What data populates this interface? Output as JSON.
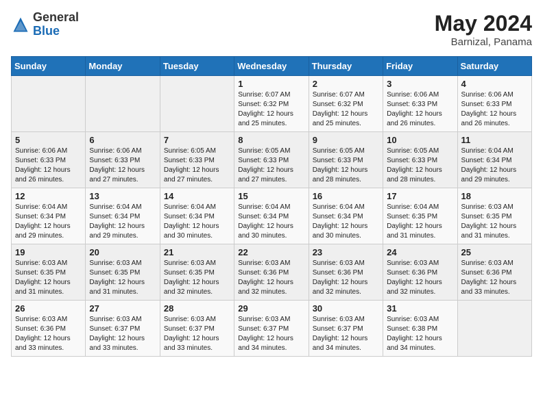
{
  "header": {
    "logo_general": "General",
    "logo_blue": "Blue",
    "month_year": "May 2024",
    "location": "Barnizal, Panama"
  },
  "weekdays": [
    "Sunday",
    "Monday",
    "Tuesday",
    "Wednesday",
    "Thursday",
    "Friday",
    "Saturday"
  ],
  "weeks": [
    [
      {
        "day": "",
        "info": ""
      },
      {
        "day": "",
        "info": ""
      },
      {
        "day": "",
        "info": ""
      },
      {
        "day": "1",
        "info": "Sunrise: 6:07 AM\nSunset: 6:32 PM\nDaylight: 12 hours\nand 25 minutes."
      },
      {
        "day": "2",
        "info": "Sunrise: 6:07 AM\nSunset: 6:32 PM\nDaylight: 12 hours\nand 25 minutes."
      },
      {
        "day": "3",
        "info": "Sunrise: 6:06 AM\nSunset: 6:33 PM\nDaylight: 12 hours\nand 26 minutes."
      },
      {
        "day": "4",
        "info": "Sunrise: 6:06 AM\nSunset: 6:33 PM\nDaylight: 12 hours\nand 26 minutes."
      }
    ],
    [
      {
        "day": "5",
        "info": "Sunrise: 6:06 AM\nSunset: 6:33 PM\nDaylight: 12 hours\nand 26 minutes."
      },
      {
        "day": "6",
        "info": "Sunrise: 6:06 AM\nSunset: 6:33 PM\nDaylight: 12 hours\nand 27 minutes."
      },
      {
        "day": "7",
        "info": "Sunrise: 6:05 AM\nSunset: 6:33 PM\nDaylight: 12 hours\nand 27 minutes."
      },
      {
        "day": "8",
        "info": "Sunrise: 6:05 AM\nSunset: 6:33 PM\nDaylight: 12 hours\nand 27 minutes."
      },
      {
        "day": "9",
        "info": "Sunrise: 6:05 AM\nSunset: 6:33 PM\nDaylight: 12 hours\nand 28 minutes."
      },
      {
        "day": "10",
        "info": "Sunrise: 6:05 AM\nSunset: 6:33 PM\nDaylight: 12 hours\nand 28 minutes."
      },
      {
        "day": "11",
        "info": "Sunrise: 6:04 AM\nSunset: 6:34 PM\nDaylight: 12 hours\nand 29 minutes."
      }
    ],
    [
      {
        "day": "12",
        "info": "Sunrise: 6:04 AM\nSunset: 6:34 PM\nDaylight: 12 hours\nand 29 minutes."
      },
      {
        "day": "13",
        "info": "Sunrise: 6:04 AM\nSunset: 6:34 PM\nDaylight: 12 hours\nand 29 minutes."
      },
      {
        "day": "14",
        "info": "Sunrise: 6:04 AM\nSunset: 6:34 PM\nDaylight: 12 hours\nand 30 minutes."
      },
      {
        "day": "15",
        "info": "Sunrise: 6:04 AM\nSunset: 6:34 PM\nDaylight: 12 hours\nand 30 minutes."
      },
      {
        "day": "16",
        "info": "Sunrise: 6:04 AM\nSunset: 6:34 PM\nDaylight: 12 hours\nand 30 minutes."
      },
      {
        "day": "17",
        "info": "Sunrise: 6:04 AM\nSunset: 6:35 PM\nDaylight: 12 hours\nand 31 minutes."
      },
      {
        "day": "18",
        "info": "Sunrise: 6:03 AM\nSunset: 6:35 PM\nDaylight: 12 hours\nand 31 minutes."
      }
    ],
    [
      {
        "day": "19",
        "info": "Sunrise: 6:03 AM\nSunset: 6:35 PM\nDaylight: 12 hours\nand 31 minutes."
      },
      {
        "day": "20",
        "info": "Sunrise: 6:03 AM\nSunset: 6:35 PM\nDaylight: 12 hours\nand 31 minutes."
      },
      {
        "day": "21",
        "info": "Sunrise: 6:03 AM\nSunset: 6:35 PM\nDaylight: 12 hours\nand 32 minutes."
      },
      {
        "day": "22",
        "info": "Sunrise: 6:03 AM\nSunset: 6:36 PM\nDaylight: 12 hours\nand 32 minutes."
      },
      {
        "day": "23",
        "info": "Sunrise: 6:03 AM\nSunset: 6:36 PM\nDaylight: 12 hours\nand 32 minutes."
      },
      {
        "day": "24",
        "info": "Sunrise: 6:03 AM\nSunset: 6:36 PM\nDaylight: 12 hours\nand 32 minutes."
      },
      {
        "day": "25",
        "info": "Sunrise: 6:03 AM\nSunset: 6:36 PM\nDaylight: 12 hours\nand 33 minutes."
      }
    ],
    [
      {
        "day": "26",
        "info": "Sunrise: 6:03 AM\nSunset: 6:36 PM\nDaylight: 12 hours\nand 33 minutes."
      },
      {
        "day": "27",
        "info": "Sunrise: 6:03 AM\nSunset: 6:37 PM\nDaylight: 12 hours\nand 33 minutes."
      },
      {
        "day": "28",
        "info": "Sunrise: 6:03 AM\nSunset: 6:37 PM\nDaylight: 12 hours\nand 33 minutes."
      },
      {
        "day": "29",
        "info": "Sunrise: 6:03 AM\nSunset: 6:37 PM\nDaylight: 12 hours\nand 34 minutes."
      },
      {
        "day": "30",
        "info": "Sunrise: 6:03 AM\nSunset: 6:37 PM\nDaylight: 12 hours\nand 34 minutes."
      },
      {
        "day": "31",
        "info": "Sunrise: 6:03 AM\nSunset: 6:38 PM\nDaylight: 12 hours\nand 34 minutes."
      },
      {
        "day": "",
        "info": ""
      }
    ]
  ]
}
